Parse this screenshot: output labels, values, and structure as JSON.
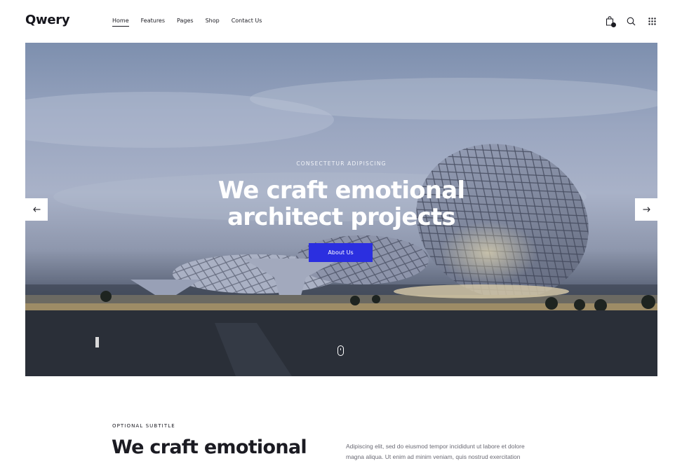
{
  "header": {
    "logo": "Qwery",
    "nav": [
      {
        "label": "Home",
        "active": true
      },
      {
        "label": "Features",
        "active": false
      },
      {
        "label": "Pages",
        "active": false
      },
      {
        "label": "Shop",
        "active": false
      },
      {
        "label": "Contact Us",
        "active": false
      }
    ],
    "icons": [
      "cart-icon",
      "search-icon",
      "grid-menu-icon"
    ]
  },
  "hero": {
    "overline": "CONSECTETUR ADIPISCING",
    "title_line1": "We craft emotional",
    "title_line2": "architect projects",
    "button_label": "About Us",
    "accent_color": "#2b2fe0",
    "prev_icon": "arrow-left-icon",
    "next_icon": "arrow-right-icon",
    "scroll_icon": "mouse-scroll-icon"
  },
  "intro": {
    "subtitle": "OPTIONAL SUBTITLE",
    "title": "We craft emotional",
    "text": "Adipiscing elit, sed do eiusmod tempor incididunt ut labore et dolore magna aliqua. Ut enim ad minim veniam, quis nostrud exercitation"
  }
}
